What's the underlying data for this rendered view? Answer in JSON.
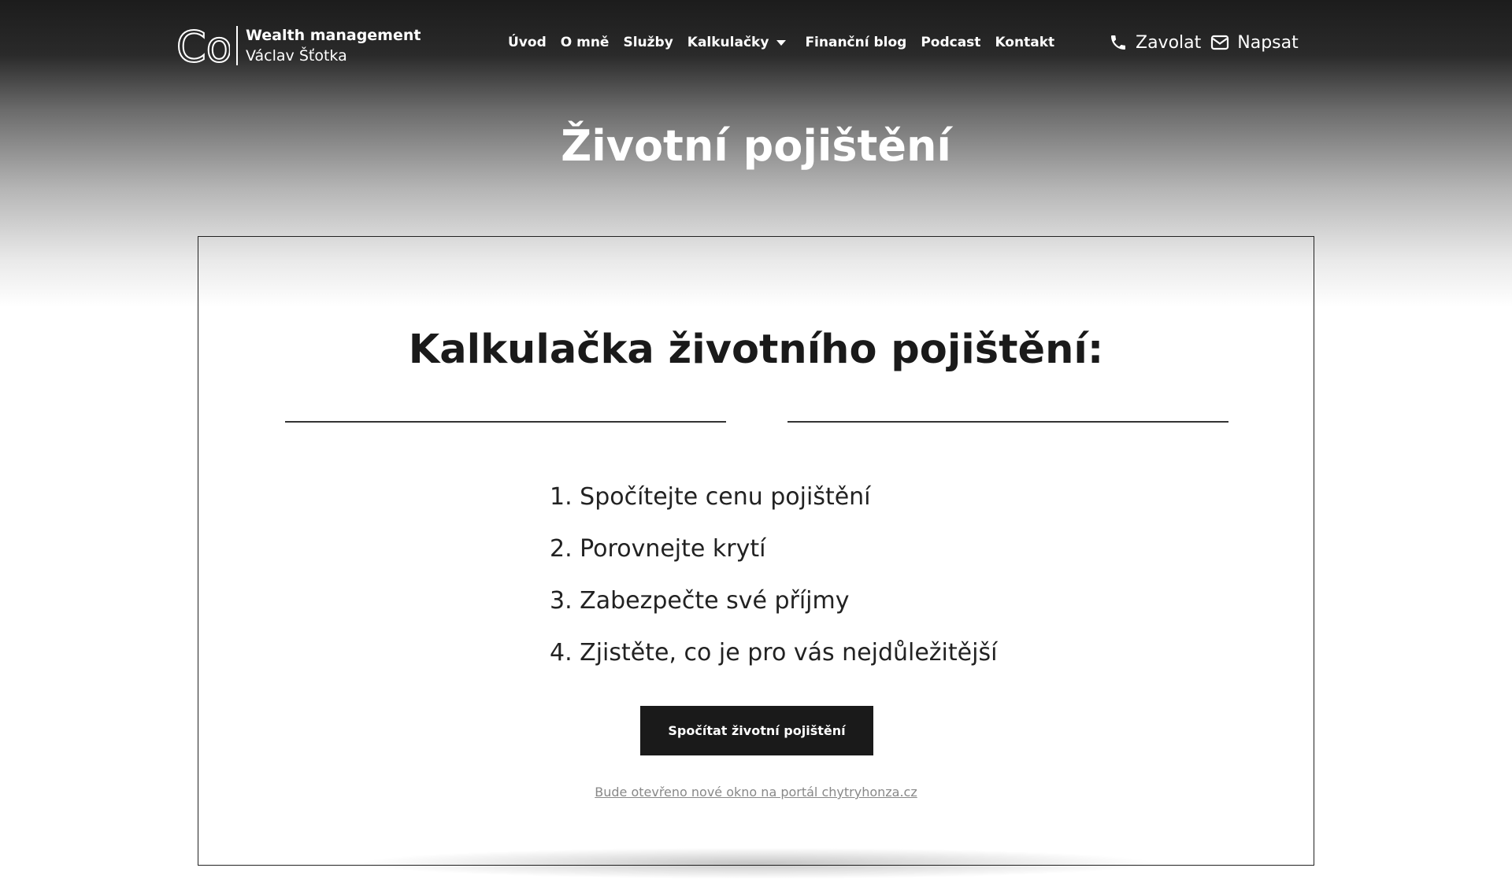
{
  "brand": {
    "title": "Wealth management",
    "name": "Václav Šťotka",
    "mark": "Co"
  },
  "nav": {
    "items": [
      "Úvod",
      "O mně",
      "Služby"
    ],
    "dropdown_label": "Kalkulačky",
    "items_after": [
      "Finanční blog",
      "Podcast",
      "Kontakt"
    ]
  },
  "contact": {
    "call_label": "Zavolat",
    "write_label": "Napsat",
    "call_icon": "phone-icon",
    "write_icon": "envelope-icon"
  },
  "page": {
    "title": "Životní pojištění"
  },
  "calculator": {
    "heading": "Kalkulačka životního pojištění:",
    "steps": [
      "1. Spočítejte cenu pojištění",
      "2. Porovnejte krytí",
      "3. Zabezpečte své příjmy",
      "4. Zjistěte, co je pro vás nejdůležitější"
    ],
    "button_label": "Spočítat životní pojištění",
    "note": "Bude otevřeno nové okno na portál chytryhonza.cz"
  },
  "colors": {
    "header_dark": "#1c1c1c",
    "button_bg": "#1a1a1a",
    "text": "#222222",
    "note": "#888888"
  }
}
